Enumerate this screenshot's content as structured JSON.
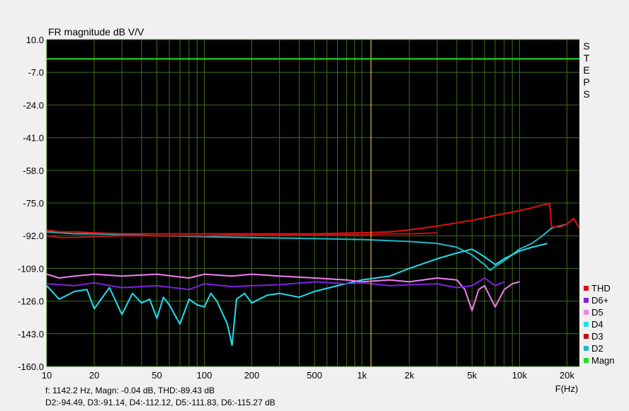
{
  "chart_data": {
    "type": "line",
    "title": "FR magnitude dB V/V",
    "xlabel": "F(Hz)",
    "x_scale": "log",
    "xlim": [
      10,
      24000
    ],
    "ylim": [
      -160,
      10
    ],
    "y_ticks": [
      10.0,
      -7.0,
      -24.0,
      -41.0,
      -58.0,
      -75.0,
      -92.0,
      -109.0,
      -126.0,
      -143.0,
      -160.0
    ],
    "y_tick_labels": [
      "10.0",
      "-7.0",
      "-24.0",
      "-41.0",
      "-58.0",
      "-75.0",
      "-92.0",
      "-109.0",
      "-126.0",
      "-143.0",
      "-160.0"
    ],
    "x_ticks": [
      10,
      20,
      50,
      100,
      200,
      500,
      1000,
      2000,
      5000,
      10000,
      20000
    ],
    "x_tick_labels": [
      "10",
      "20",
      "50",
      "100",
      "200",
      "500",
      "1k",
      "2k",
      "5k",
      "10k",
      "20k"
    ],
    "cursor_x": 1142.2,
    "side_label": "STEPS",
    "grid": true,
    "background": "#000000",
    "grid_color": "#3c6e1e",
    "cursor_color": "#d8c040",
    "legend_position": "right",
    "series": [
      {
        "name": "THD",
        "color": "#e01010",
        "x": [
          10,
          12,
          15,
          20,
          30,
          50,
          100,
          200,
          500,
          1000,
          1500,
          2000,
          3000,
          5000,
          8000,
          10000,
          12000,
          14000,
          15000,
          15500,
          16000,
          18000,
          20000,
          22000,
          24000
        ],
        "y": [
          -89,
          -90,
          -90,
          -90.5,
          -91,
          -91,
          -91,
          -91,
          -91,
          -90.5,
          -90,
          -89,
          -87,
          -84,
          -80.5,
          -79,
          -77.5,
          -76,
          -75.5,
          -75,
          -87.5,
          -87.5,
          -86,
          -83,
          -88
        ]
      },
      {
        "name": "D6+",
        "color": "#8020e0",
        "x": [
          10,
          15,
          20,
          30,
          50,
          80,
          100,
          150,
          200,
          300,
          500,
          800,
          1000,
          1500,
          2000,
          3000,
          4000,
          5000,
          6000,
          7000,
          8000
        ],
        "y": [
          -117,
          -118,
          -116.5,
          -119,
          -118,
          -120,
          -117,
          -118.5,
          -118,
          -117.5,
          -116,
          -117,
          -116.5,
          -118,
          -117.5,
          -117,
          -119,
          -118,
          -114,
          -118,
          -116
        ]
      },
      {
        "name": "D5",
        "color": "#f080f0",
        "x": [
          10,
          12,
          15,
          20,
          30,
          50,
          80,
          100,
          150,
          200,
          300,
          500,
          800,
          1000,
          1500,
          2000,
          3000,
          4000,
          4500,
          5000,
          5500,
          6000,
          7000,
          8000,
          9000,
          10000
        ],
        "y": [
          -112,
          -114,
          -113,
          -112,
          -113,
          -112,
          -114,
          -112,
          -113,
          -112,
          -113,
          -114,
          -115,
          -116,
          -115,
          -116,
          -114,
          -115,
          -120,
          -131,
          -120,
          -118,
          -129,
          -120,
          -117,
          -116
        ]
      },
      {
        "name": "D4",
        "color": "#20e0f0",
        "x": [
          10,
          12,
          15,
          18,
          20,
          25,
          30,
          35,
          40,
          45,
          50,
          55,
          60,
          70,
          80,
          90,
          100,
          110,
          120,
          140,
          150,
          160,
          180,
          200,
          250,
          300,
          400,
          500,
          700,
          1000,
          1500,
          2000,
          3000,
          4000,
          5000,
          6000,
          7000,
          8000,
          10000,
          12000,
          15000
        ],
        "y": [
          -118,
          -125,
          -121,
          -120,
          -130,
          -119,
          -133,
          -122,
          -127,
          -125,
          -135,
          -124,
          -128,
          -138,
          -125,
          -128,
          -129,
          -122,
          -126,
          -138,
          -149,
          -125,
          -122,
          -127,
          -123,
          -122,
          -124,
          -121,
          -118,
          -115,
          -113,
          -109,
          -104,
          -101,
          -99,
          -103,
          -107,
          -104,
          -100,
          -98,
          -96
        ]
      },
      {
        "name": "D3",
        "color": "#c01010",
        "x": [
          10,
          12,
          15,
          20,
          30,
          50,
          100,
          200,
          500,
          1000,
          1500,
          2000,
          3000
        ],
        "y": [
          -92,
          -93,
          -93,
          -92.5,
          -92,
          -92,
          -92,
          -91.5,
          -91.5,
          -91.5,
          -91,
          -91,
          -90.5
        ]
      },
      {
        "name": "D2",
        "color": "#20b8c8",
        "x": [
          10,
          15,
          20,
          30,
          50,
          100,
          200,
          500,
          1000,
          2000,
          3000,
          4000,
          5000,
          6000,
          6500,
          7000,
          8000,
          10000,
          12000,
          14000,
          16000,
          18000,
          20000
        ],
        "y": [
          -90,
          -91,
          -91,
          -91.5,
          -92,
          -92.5,
          -93,
          -93.5,
          -94,
          -95,
          -96,
          -98,
          -102,
          -107,
          -110,
          -108,
          -105,
          -99,
          -96,
          -92,
          -88,
          -87,
          -86
        ]
      },
      {
        "name": "Magn",
        "color": "#20e020",
        "x": [
          10,
          24000
        ],
        "y": [
          -0.04,
          -0.04
        ]
      }
    ],
    "readout_line1": "f: 1142.2 Hz, Magn: -0.04 dB, THD:-89.43  dB",
    "readout_line2": "D2:-94.49, D3:-91.14, D4:-112.12, D5:-111.83, D6:-115.27 dB"
  }
}
